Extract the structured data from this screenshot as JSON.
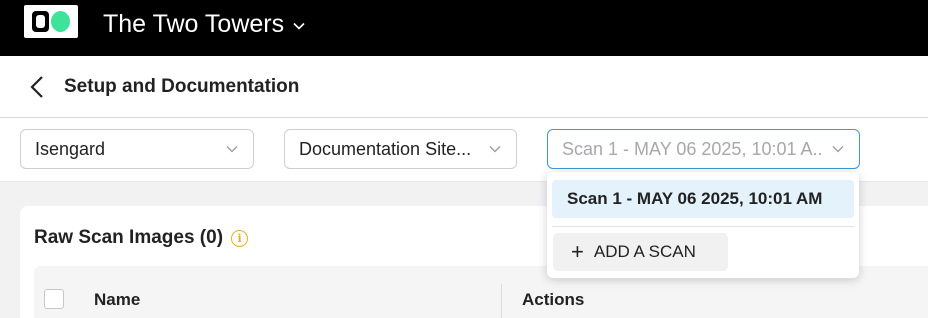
{
  "app": {
    "project_name": "The Two Towers",
    "project_chevron_icon": "chevron-down-icon",
    "logo": "app-logo"
  },
  "header": {
    "back_icon": "chevron-left-icon",
    "title": "Setup and Documentation"
  },
  "filters": {
    "location": {
      "value": "Isengard"
    },
    "site": {
      "value": "Documentation Site..."
    },
    "scan": {
      "value": "Scan 1 - MAY 06 2025, 10:01 A..."
    }
  },
  "scan_menu": {
    "items": [
      {
        "label": "Scan 1 - MAY 06 2025, 10:01 AM",
        "selected": true
      }
    ],
    "add_label": "ADD A SCAN",
    "add_icon": "plus-icon"
  },
  "raw_scans": {
    "title": "Raw Scan Images (0)",
    "info_icon": "info-icon",
    "columns": [
      "Name",
      "Actions"
    ]
  },
  "colors": {
    "topbar": "#000000",
    "logo_accent": "#3ee39a",
    "focus_border": "#3a9bd8",
    "selected_item_bg": "#e4f2fb",
    "info_icon": "#e2b21c"
  }
}
